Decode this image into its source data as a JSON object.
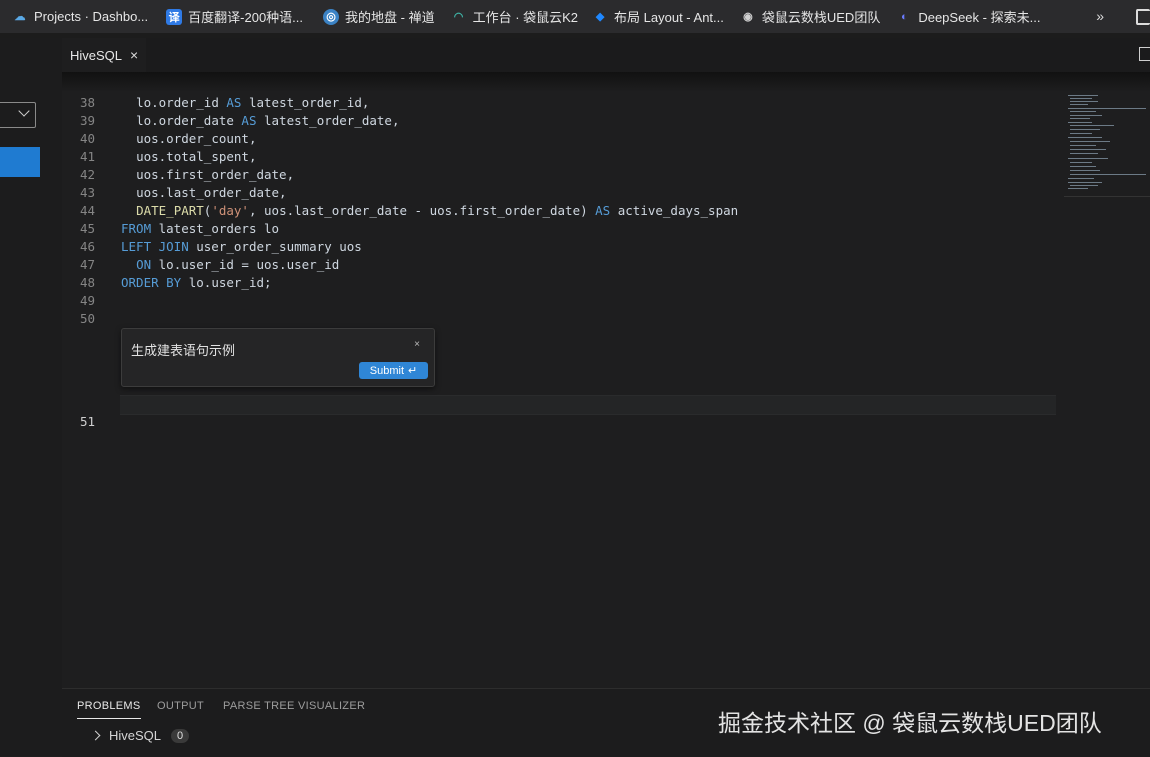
{
  "bookmarks": [
    {
      "label": "Projects · Dashbo...",
      "icon": "cloud-icon"
    },
    {
      "label": "百度翻译-200种语...",
      "icon": "translate-icon"
    },
    {
      "label": "我的地盘 - 禅道",
      "icon": "zentao-icon"
    },
    {
      "label": "工作台 · 袋鼠云K2",
      "icon": "k2-icon"
    },
    {
      "label": "布局 Layout - Ant...",
      "icon": "ant-design-icon"
    },
    {
      "label": "袋鼠云数栈UED团队",
      "icon": "globe-icon"
    },
    {
      "label": "DeepSeek - 探索未...",
      "icon": "deepseek-icon"
    }
  ],
  "bookmarks_more": "»",
  "tab": {
    "title": "HiveSQL",
    "close": "×"
  },
  "code": {
    "lines": [
      {
        "n": "38",
        "indent": "  ",
        "parts": [
          [
            "",
            "lo.order_id "
          ],
          [
            "kw",
            "AS"
          ],
          [
            "",
            " latest_order_id,"
          ]
        ]
      },
      {
        "n": "39",
        "indent": "  ",
        "parts": [
          [
            "",
            "lo.order_date "
          ],
          [
            "kw",
            "AS"
          ],
          [
            "",
            " latest_order_date,"
          ]
        ]
      },
      {
        "n": "40",
        "indent": "  ",
        "parts": [
          [
            "",
            "uos.order_count,"
          ]
        ]
      },
      {
        "n": "41",
        "indent": "  ",
        "parts": [
          [
            "",
            "uos.total_spent,"
          ]
        ]
      },
      {
        "n": "42",
        "indent": "  ",
        "parts": [
          [
            "",
            "uos.first_order_date,"
          ]
        ]
      },
      {
        "n": "43",
        "indent": "  ",
        "parts": [
          [
            "",
            "uos.last_order_date,"
          ]
        ]
      },
      {
        "n": "44",
        "indent": "  ",
        "parts": [
          [
            "fn2",
            "DATE_PART"
          ],
          [
            "",
            "("
          ],
          [
            "str",
            "'day'"
          ],
          [
            "",
            ", uos.last_order_date - uos.first_order_date) "
          ],
          [
            "kw",
            "AS"
          ],
          [
            "",
            " active_days_span"
          ]
        ]
      },
      {
        "n": "45",
        "indent": "",
        "parts": [
          [
            "kw",
            "FROM"
          ],
          [
            "",
            " latest_orders lo"
          ]
        ]
      },
      {
        "n": "46",
        "indent": "",
        "parts": [
          [
            "kw",
            "LEFT JOIN"
          ],
          [
            "",
            " user_order_summary uos"
          ]
        ]
      },
      {
        "n": "47",
        "indent": "  ",
        "parts": [
          [
            "kw",
            "ON"
          ],
          [
            "",
            " lo.user_id = uos.user_id"
          ]
        ]
      },
      {
        "n": "48",
        "indent": "",
        "parts": [
          [
            "kw",
            "ORDER BY"
          ],
          [
            "",
            " lo.user_id;"
          ]
        ]
      },
      {
        "n": "49",
        "indent": "",
        "parts": []
      },
      {
        "n": "50",
        "indent": "",
        "parts": []
      }
    ],
    "last_line_number": "51"
  },
  "ai_widget": {
    "prompt": "生成建表语句示例",
    "close": "×",
    "submit_label": "Submit",
    "submit_key": "↵"
  },
  "panel": {
    "tabs": [
      "PROBLEMS",
      "OUTPUT",
      "PARSE TREE VISUALIZER"
    ],
    "active_tab": "PROBLEMS",
    "tree_item": "HiveSQL",
    "tree_count": "0"
  },
  "watermark": "掘金技术社区 @ 袋鼠云数栈UED团队"
}
